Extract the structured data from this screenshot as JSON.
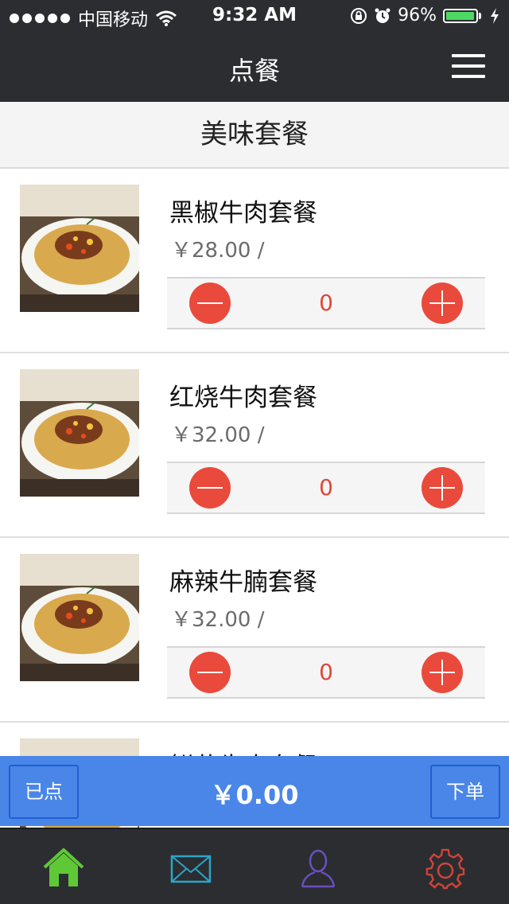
{
  "status_bar": {
    "carrier": "中国移动",
    "time": "9:32 AM",
    "battery": "96%",
    "battery_level": 0.96
  },
  "nav": {
    "title": "点餐"
  },
  "section": {
    "title": "美味套餐"
  },
  "items": [
    {
      "name": "黑椒牛肉套餐",
      "price": "￥28.00 /",
      "qty": "0"
    },
    {
      "name": "红烧牛肉套餐",
      "price": "￥32.00 /",
      "qty": "0"
    },
    {
      "name": "麻辣牛腩套餐",
      "price": "￥32.00 /",
      "qty": "0"
    },
    {
      "name": "鲜菇牛肉套餐",
      "price": "",
      "qty": ""
    }
  ],
  "cart": {
    "ordered_label": "已点",
    "total": "￥0.00",
    "submit_label": "下单"
  },
  "tabs": [
    {
      "icon": "home-icon",
      "color": "#5fc837"
    },
    {
      "icon": "mail-icon",
      "color": "#2aa6c9"
    },
    {
      "icon": "user-icon",
      "color": "#6a4fc0"
    },
    {
      "icon": "settings-icon",
      "color": "#d0443a"
    }
  ],
  "colors": {
    "accent_red": "#ea4a3b",
    "cart_blue": "#4a86e8",
    "bar_dark": "#2b2d31"
  }
}
